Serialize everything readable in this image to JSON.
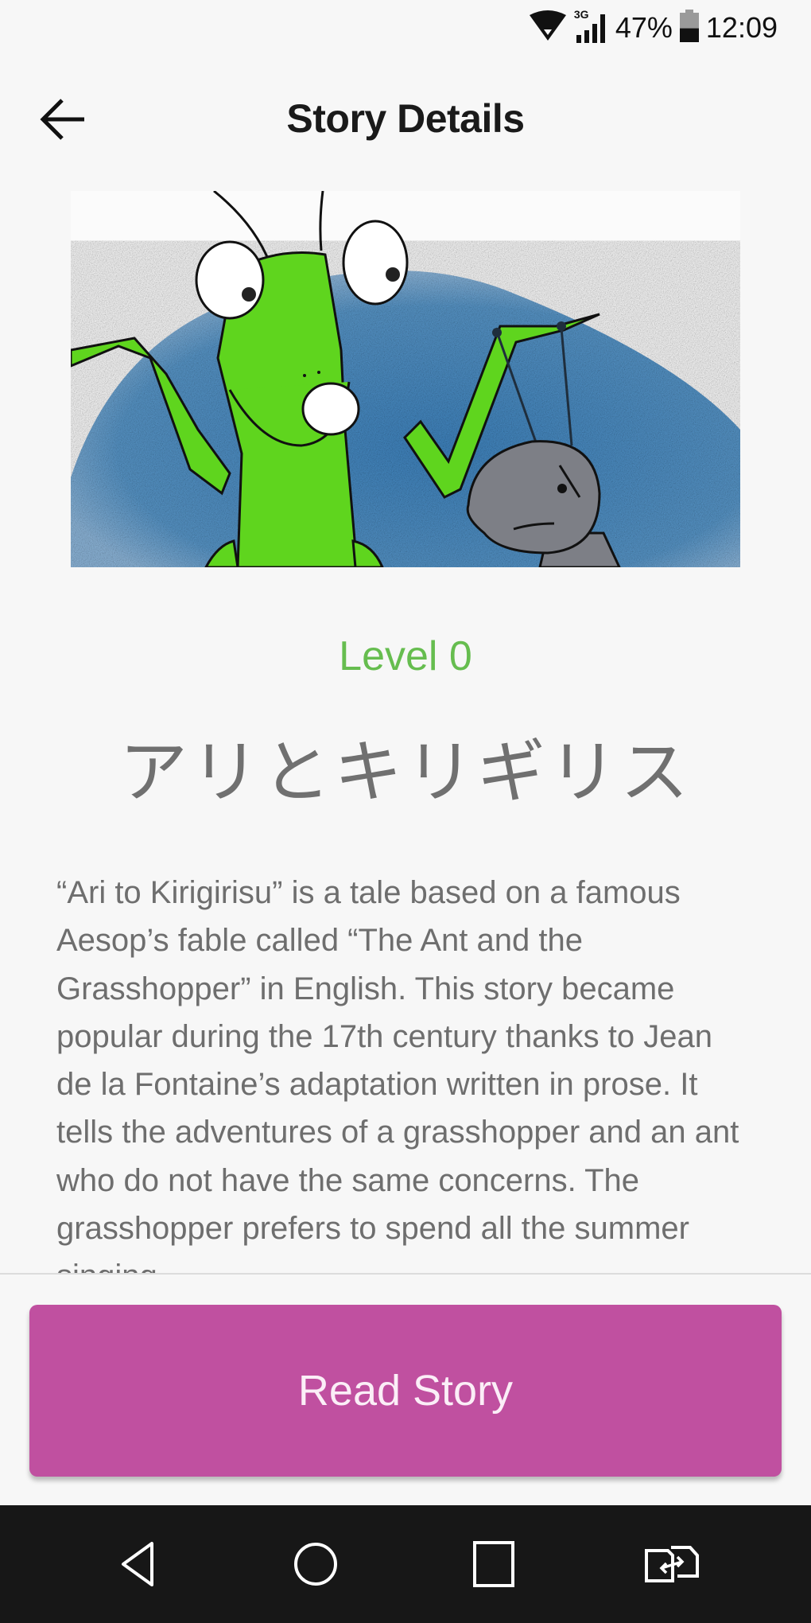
{
  "status_bar": {
    "network_label": "3G",
    "battery_percent": "47%",
    "battery_level": 0.47,
    "time": "12:09",
    "icons": [
      "wifi-icon",
      "cellular-signal-icon",
      "battery-icon"
    ]
  },
  "app_bar": {
    "title": "Story Details",
    "back_icon": "arrow-left-icon"
  },
  "hero_image": {
    "description": "Illustration of a green grasshopper shrugging next to a frowning grey ant on a blue background",
    "colors": {
      "grasshopper": "#5fd51e",
      "ant": "#7d7f86",
      "background_blob": "#4d8fc4"
    }
  },
  "story": {
    "level": "Level 0",
    "title": "アリとキリギリス",
    "description": "“Ari to Kirigirisu” is a tale based on a famous Aesop’s fable called “The Ant and the Grasshopper” in English. This story became popular during the 17th century thanks to Jean de la Fontaine’s adaptation written in prose. It tells the adventures of a grasshopper and an ant who do not have the same concerns. The grasshopper prefers to spend all the summer singing"
  },
  "actions": {
    "read_story_label": "Read Story"
  },
  "nav_bar": {
    "items": [
      "back-icon",
      "home-icon",
      "recents-icon",
      "switch-sim-icon"
    ]
  },
  "colors": {
    "level_green": "#66bd4f",
    "primary_button": "#c050a0",
    "nav_bar": "#171717"
  }
}
